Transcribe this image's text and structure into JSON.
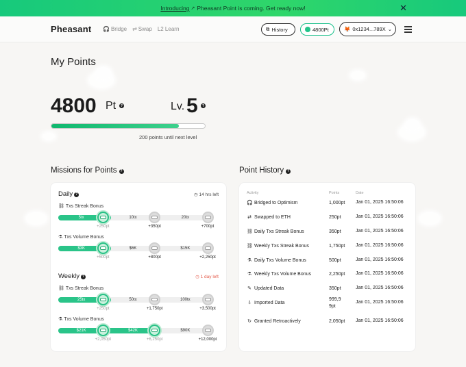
{
  "banner": {
    "link_text": "Introducing",
    "message": "Pheasant Point is coming. Get ready now!"
  },
  "header": {
    "logo": "Pheasant",
    "nav": [
      {
        "label": "Bridge",
        "icon": "headset-icon"
      },
      {
        "label": "Swap",
        "icon": "swap-icon"
      },
      {
        "label": "L2 Learn",
        "icon": ""
      }
    ],
    "history_label": "History",
    "points_label": "4800Pt",
    "wallet_label": "0x1234...789X"
  },
  "summary": {
    "title": "My Points",
    "points": "4800",
    "unit": "Pt",
    "level_label": "Lv.",
    "level": "5",
    "progress_fraction": 0.83,
    "progress_text": "200 points until next level"
  },
  "missions": {
    "title": "Missions for Points",
    "groups": [
      {
        "name": "Daily",
        "time": "14 hrs left",
        "time_color": "#444444",
        "missions": [
          {
            "name": "Txs Streak Bonus",
            "fill": 0.34,
            "steps": [
              {
                "label": "5tx",
                "reward": "+250pt",
                "done": true
              },
              {
                "label": "10tx",
                "reward": "+350pt",
                "done": false
              },
              {
                "label": "20tx",
                "reward": "+700pt",
                "done": false
              }
            ]
          },
          {
            "name": "Txs Volume Bonus",
            "fill": 0.34,
            "steps": [
              {
                "label": "$3K",
                "reward": "+500pt",
                "done": true
              },
              {
                "label": "$6K",
                "reward": "+800pt",
                "done": false
              },
              {
                "label": "$15K",
                "reward": "+2,250pt",
                "done": false
              }
            ]
          }
        ]
      },
      {
        "name": "Weekly",
        "time": "1 day left",
        "time_color": "#e45b4b",
        "missions": [
          {
            "name": "Txs Streak Bonus",
            "fill": 0.34,
            "steps": [
              {
                "label": "25tx",
                "reward": "+250pt",
                "done": true
              },
              {
                "label": "50tx",
                "reward": "+1,750pt",
                "done": false
              },
              {
                "label": "100tx",
                "reward": "+3,500pt",
                "done": false
              }
            ]
          },
          {
            "name": "Txs Volume Bonus",
            "fill": 0.67,
            "steps": [
              {
                "label": "$21K",
                "reward": "+2,050pt",
                "done": true
              },
              {
                "label": "$42K",
                "reward": "+6,250pt",
                "done": true
              },
              {
                "label": "$90K",
                "reward": "+12,000pt",
                "done": false
              }
            ]
          }
        ]
      }
    ]
  },
  "history": {
    "title": "Point History",
    "columns": [
      "Activity",
      "Points",
      "Date"
    ],
    "rows": [
      {
        "icon": "headset-icon",
        "activity": "Bridged to Optimism",
        "points": "1,000pt",
        "date": "Jan 01, 2025 16:50:06"
      },
      {
        "icon": "swap-icon",
        "activity": "Swapped to ETH",
        "points": "250pt",
        "date": "Jan 01, 2025 16:50:06"
      },
      {
        "icon": "streak-icon",
        "activity": "Daily Txs Streak Bonus",
        "points": "350pt",
        "date": "Jan 01, 2025 16:50:06"
      },
      {
        "icon": "streak-icon",
        "activity": "Weekly Txs Streak Bonus",
        "points": "1,750pt",
        "date": "Jan 01, 2025 16:50:06"
      },
      {
        "icon": "volume-icon",
        "activity": "Daily Txs Volume Bonus",
        "points": "500pt",
        "date": "Jan 01, 2025 16:50:06"
      },
      {
        "icon": "volume-icon",
        "activity": "Weekly Txs Volume Bonus",
        "points": "2,250pt",
        "date": "Jan 01, 2025 16:50:06"
      },
      {
        "icon": "edit-icon",
        "activity": "Updated Data",
        "points": "350pt",
        "date": "Jan 01, 2025 16:50:06"
      },
      {
        "icon": "import-icon",
        "activity": "Imported Data",
        "points": "999,9\n9pt",
        "date": "Jan 01, 2025 16:50:06"
      },
      {
        "icon": "retro-icon",
        "activity": "Granted Retroactively",
        "points": "2,050pt",
        "date": "Jan 01, 2025 16:50:06"
      }
    ]
  },
  "colors": {
    "accent": "#19c08a",
    "banner": "#2fd66a",
    "warning": "#e45b4b"
  }
}
